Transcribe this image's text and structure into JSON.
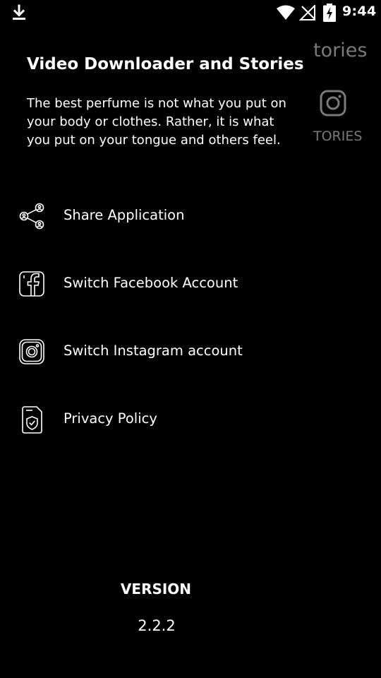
{
  "status_bar": {
    "time": "9:44",
    "icons": [
      "download-icon",
      "wifi-icon",
      "no-signal-icon",
      "battery-charging-icon"
    ]
  },
  "background_app": {
    "title_fragment": "tories",
    "label_fragment": "TORIES",
    "icon": "instagram-icon"
  },
  "drawer": {
    "title": "Video Downloader and Stories",
    "quote": "The best perfume is not what you put on your body or clothes. Rather, it is what you put on your tongue and others feel.",
    "menu": [
      {
        "icon": "share-icon",
        "label": "Share Application"
      },
      {
        "icon": "facebook-icon",
        "label": "Switch Facebook Account"
      },
      {
        "icon": "instagram-icon",
        "label": "Switch Instagram account"
      },
      {
        "icon": "privacy-shield-icon",
        "label": "Privacy Policy"
      }
    ],
    "version_label": "VERSION",
    "version_number": "2.2.2"
  },
  "colors": {
    "background": "#000000",
    "text": "#ffffff",
    "dimmed_text": "#7a7a7a"
  }
}
